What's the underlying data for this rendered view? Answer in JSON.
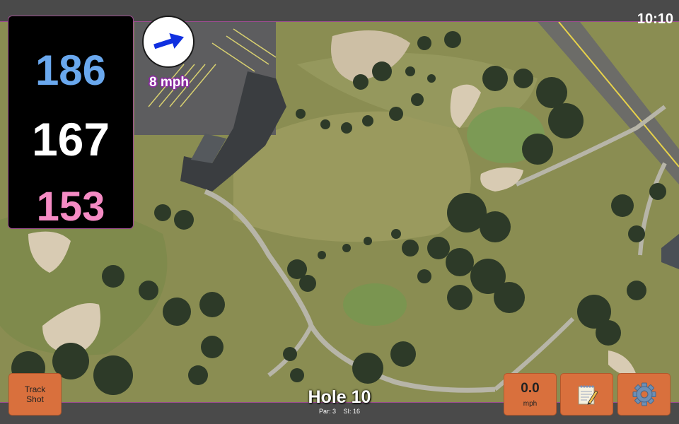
{
  "status_bar": {
    "clock": "10:10"
  },
  "yardages": {
    "back": "186",
    "center": "167",
    "front": "153"
  },
  "wind": {
    "speed_label": "8 mph",
    "arrow_icon": "arrow-right-icon",
    "arrow_color": "#1030e0"
  },
  "buttons": {
    "track_shot": "Track\nShot",
    "speed_value": "0.0",
    "speed_unit": "mph",
    "notes_icon": "notepad-icon",
    "settings_icon": "gear-icon"
  },
  "hole": {
    "title": "Hole 10",
    "par": "Par: 3",
    "si": "SI: 16"
  },
  "colors": {
    "back_yardage": "#6aa8ee",
    "center_yardage": "#ffffff",
    "front_yardage": "#f58bc4",
    "button_orange": "#d9703d",
    "border_purple": "#9b4c8f"
  }
}
